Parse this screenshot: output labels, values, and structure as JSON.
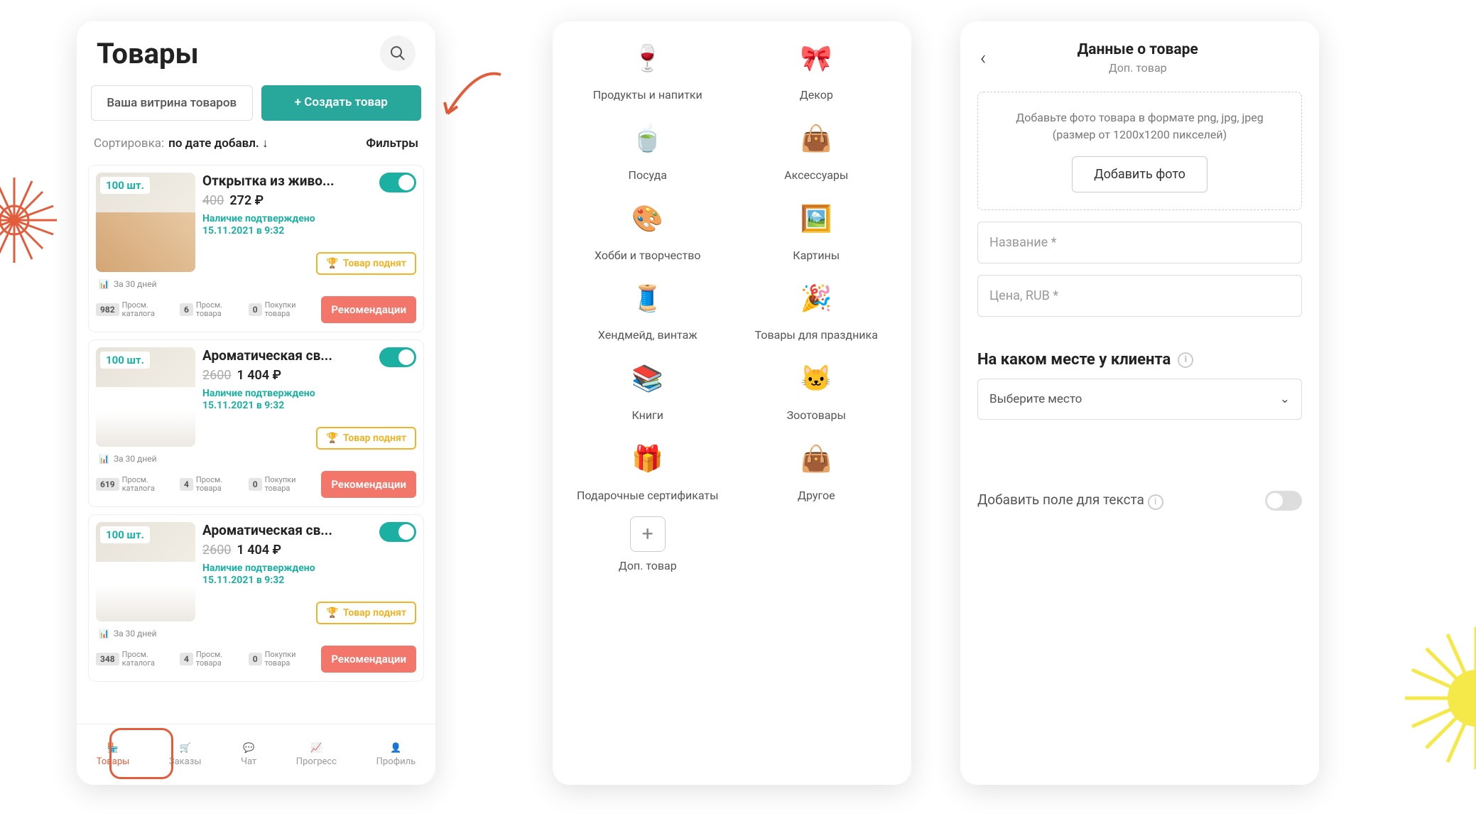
{
  "phone1": {
    "title": "Товары",
    "showcase_btn": "Ваша витрина товаров",
    "create_btn": "+ Создать товар",
    "sort_label": "Сортировка:",
    "sort_value": "по дате добавл. ↓",
    "filters": "Фильтры",
    "products": [
      {
        "qty": "100 шт.",
        "title": "Открытка из живо...",
        "old_price": "400",
        "price": "272 ₽",
        "avail": "Наличие подтверждено",
        "date": "15.11.2021 в 9:32",
        "raise": "Товар поднят",
        "days30": "За 30 дней",
        "views": "982",
        "views_lbl": "Просм. каталога",
        "pv": "6",
        "pv_lbl": "Просм. товара",
        "buys": "0",
        "buys_lbl": "Покупки товара",
        "rec": "Рекомендации"
      },
      {
        "qty": "100 шт.",
        "title": "Ароматическая св...",
        "old_price": "2600",
        "price": "1 404 ₽",
        "avail": "Наличие подтверждено",
        "date": "15.11.2021 в 9:32",
        "raise": "Товар поднят",
        "days30": "За 30 дней",
        "views": "619",
        "views_lbl": "Просм. каталога",
        "pv": "4",
        "pv_lbl": "Просм. товара",
        "buys": "0",
        "buys_lbl": "Покупки товара",
        "rec": "Рекомендации"
      },
      {
        "qty": "100 шт.",
        "title": "Ароматическая св...",
        "old_price": "2600",
        "price": "1 404 ₽",
        "avail": "Наличие подтверждено",
        "date": "15.11.2021 в 9:32",
        "raise": "Товар поднят",
        "days30": "За 30 дней",
        "views": "348",
        "views_lbl": "Просм. каталога",
        "pv": "4",
        "pv_lbl": "Просм. товара",
        "buys": "0",
        "buys_lbl": "Покупки товара",
        "rec": "Рекомендации"
      }
    ],
    "nav": {
      "products": "Товары",
      "orders": "Заказы",
      "chat": "Чат",
      "progress": "Прогресс",
      "profile": "Профиль"
    }
  },
  "phone2": {
    "categories": [
      {
        "icon": "🍷",
        "label": "Продукты и напитки"
      },
      {
        "icon": "🎀",
        "label": "Декор"
      },
      {
        "icon": "🍵",
        "label": "Посуда"
      },
      {
        "icon": "👜",
        "label": "Аксессуары"
      },
      {
        "icon": "🎨",
        "label": "Хобби и творчество"
      },
      {
        "icon": "🖼️",
        "label": "Картины"
      },
      {
        "icon": "🧵",
        "label": "Хендмейд, винтаж"
      },
      {
        "icon": "🎉",
        "label": "Товары для праздника"
      },
      {
        "icon": "📚",
        "label": "Книги"
      },
      {
        "icon": "🐱",
        "label": "Зоотовары"
      },
      {
        "icon": "🎁",
        "label": "Подарочные сертификаты"
      },
      {
        "icon": "👜",
        "label": "Другое"
      }
    ],
    "additional": "Доп. товар"
  },
  "phone3": {
    "title": "Данные о товаре",
    "subtitle": "Доп. товар",
    "dropzone_text": "Добавьте фото товара в формате png, jpg, jpeg (размер от 1200х1200 пикселей)",
    "add_photo": "Добавить фото",
    "name_ph": "Название *",
    "price_ph": "Цена, RUB *",
    "section": "На каком месте у клиента",
    "select_ph": "Выберите место",
    "addtext": "Добавить поле для текста"
  }
}
